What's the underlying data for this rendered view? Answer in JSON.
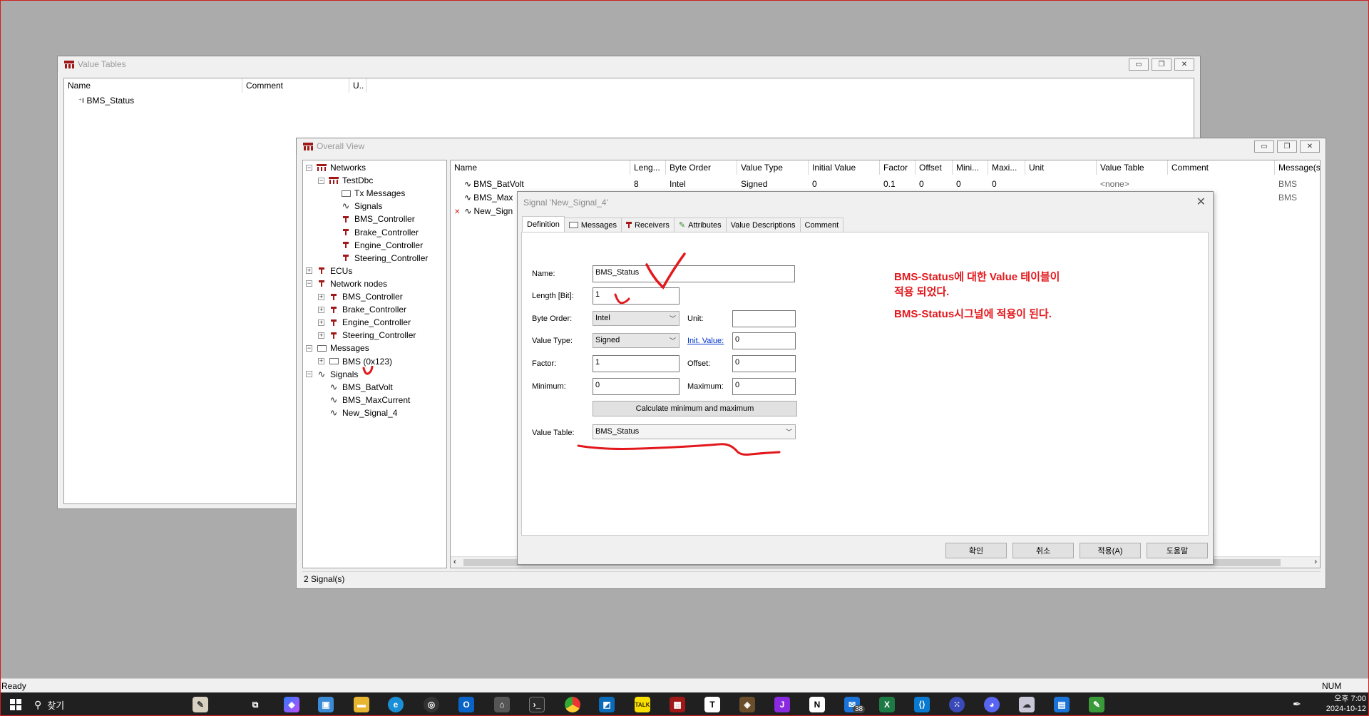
{
  "value_tables_window": {
    "title": "Value Tables",
    "columns": [
      "Name",
      "Comment",
      "U.."
    ],
    "rows": [
      {
        "name": "BMS_Status"
      }
    ]
  },
  "overall_view_window": {
    "title": "Overall View",
    "tree": [
      {
        "label": "Networks",
        "level": 0,
        "expander": "−",
        "icon": "network-icon"
      },
      {
        "label": "TestDbc",
        "level": 1,
        "expander": "−",
        "icon": "network-icon"
      },
      {
        "label": "Tx Messages",
        "level": 2,
        "expander": "",
        "icon": "envelope-icon"
      },
      {
        "label": "Signals",
        "level": 2,
        "expander": "",
        "icon": "signal-icon"
      },
      {
        "label": "BMS_Controller",
        "level": 2,
        "expander": "",
        "icon": "ecu-icon"
      },
      {
        "label": "Brake_Controller",
        "level": 2,
        "expander": "",
        "icon": "ecu-icon"
      },
      {
        "label": "Engine_Controller",
        "level": 2,
        "expander": "",
        "icon": "ecu-icon"
      },
      {
        "label": "Steering_Controller",
        "level": 2,
        "expander": "",
        "icon": "ecu-icon"
      },
      {
        "label": "ECUs",
        "level": 0,
        "expander": "+",
        "icon": "ecu-icon"
      },
      {
        "label": "Network nodes",
        "level": 0,
        "expander": "−",
        "icon": "ecu-icon"
      },
      {
        "label": "BMS_Controller",
        "level": 1,
        "expander": "+",
        "icon": "ecu-icon"
      },
      {
        "label": "Brake_Controller",
        "level": 1,
        "expander": "+",
        "icon": "ecu-icon"
      },
      {
        "label": "Engine_Controller",
        "level": 1,
        "expander": "+",
        "icon": "ecu-icon"
      },
      {
        "label": "Steering_Controller",
        "level": 1,
        "expander": "+",
        "icon": "ecu-icon"
      },
      {
        "label": "Messages",
        "level": 0,
        "expander": "−",
        "icon": "envelope-icon"
      },
      {
        "label": "BMS (0x123)",
        "level": 1,
        "expander": "+",
        "icon": "envelope-icon"
      },
      {
        "label": "Signals",
        "level": 0,
        "expander": "−",
        "icon": "signal-icon"
      },
      {
        "label": "BMS_BatVolt",
        "level": 1,
        "expander": "",
        "icon": "signal-icon"
      },
      {
        "label": "BMS_MaxCurrent",
        "level": 1,
        "expander": "",
        "icon": "signal-icon"
      },
      {
        "label": "New_Signal_4",
        "level": 1,
        "expander": "",
        "icon": "signal-icon"
      }
    ],
    "columns": [
      "Name",
      "Leng...",
      "Byte Order",
      "Value Type",
      "Initial Value",
      "Factor",
      "Offset",
      "Mini...",
      "Maxi...",
      "Unit",
      "Value Table",
      "Comment",
      "Message(s)"
    ],
    "rows": [
      {
        "cells": [
          "BMS_BatVolt",
          "8",
          "Intel",
          "Signed",
          "0",
          "0.1",
          "0",
          "0",
          "0",
          "",
          "<none>",
          "",
          "BMS"
        ],
        "error": false
      },
      {
        "cells": [
          "BMS_Max",
          "",
          "",
          "",
          "",
          "",
          "",
          "",
          "",
          "",
          "",
          "",
          "BMS"
        ],
        "error": false
      },
      {
        "cells": [
          "New_Sign",
          "",
          "",
          "",
          "",
          "",
          "",
          "",
          "",
          "",
          "",
          "",
          ""
        ],
        "error": true
      }
    ],
    "status": "2 Signal(s)"
  },
  "signal_dialog": {
    "title": "Signal 'New_Signal_4'",
    "tabs": [
      "Definition",
      "Messages",
      "Receivers",
      "Attributes",
      "Value Descriptions",
      "Comment"
    ],
    "active_tab": "Definition",
    "labels": {
      "name": "Name:",
      "length": "Length [Bit]:",
      "byte_order": "Byte Order:",
      "unit": "Unit:",
      "value_type": "Value Type:",
      "init_value": "Init. Value:",
      "factor": "Factor:",
      "offset": "Offset:",
      "minimum": "Minimum:",
      "maximum": "Maximum:",
      "value_table": "Value Table:"
    },
    "values": {
      "name": "BMS_Status",
      "length": "1",
      "byte_order": "Intel",
      "unit": "",
      "value_type": "Signed",
      "init_value": "0",
      "factor": "1",
      "offset": "0",
      "minimum": "0",
      "maximum": "0",
      "value_table": "BMS_Status"
    },
    "calc_button": "Calculate minimum and maximum",
    "buttons": {
      "ok": "확인",
      "cancel": "취소",
      "apply": "적용(A)",
      "help": "도움말"
    }
  },
  "annotations": {
    "line1": "BMS-Status에 대한 Value 테이블이",
    "line2": "적용 되었다.",
    "line3": "BMS-Status시그널에 적용이 된다.",
    "color": "#e3181c"
  },
  "app_status": {
    "left": "Ready",
    "right": "NUM"
  },
  "taskbar": {
    "search": "찾기",
    "clock_time": "오후 7:00",
    "clock_date": "2024-10-12",
    "badge": "38"
  }
}
